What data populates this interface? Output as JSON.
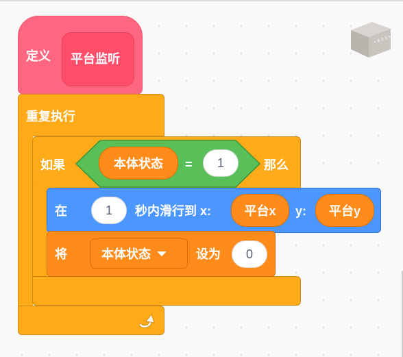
{
  "define_block": {
    "keyword": "定义",
    "proc_name": "平台监听"
  },
  "forever_block": {
    "label": "重复执行",
    "loop_icon": "loop-arrow-icon"
  },
  "if_block": {
    "if_label": "如果",
    "condition": {
      "operator": "=",
      "left_reporter": "本体状态",
      "right_value": "1"
    },
    "then_label": "那么"
  },
  "glide_block": {
    "prefix": "在",
    "seconds": "1",
    "middle": "秒内滑行到 x:",
    "x_reporter": "平台x",
    "y_label": "y:",
    "y_reporter": "平台y"
  },
  "set_block": {
    "prefix": "将",
    "variable": "本体状态",
    "dropdown_icon": "caret-down-icon",
    "middle": "设为",
    "value": "0"
  },
  "colors": {
    "define": "#ff6680",
    "control": "#ffab19",
    "motion": "#4c97ff",
    "operator": "#59c059",
    "variable": "#ff8c1a"
  },
  "sprite_icon": "costume-cube-icon"
}
